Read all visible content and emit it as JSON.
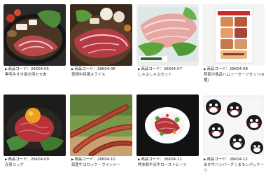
{
  "products": [
    {
      "code": "商品コード：26K04-05",
      "name": "黒毛牛すき焼き用モモ肉",
      "image_icon": "sukiyaki-pot-image"
    },
    {
      "code": "商品コード：26K04-06",
      "name": "宮崎牛特選スライス",
      "image_icon": "beef-slice-image"
    },
    {
      "code": "商品コード：26K04-07",
      "name": "しゃぶしゃぶセット",
      "image_icon": "pork-shabu-image"
    },
    {
      "code": "商品コード：26K04-08",
      "name": "阿部の逸品ハムソーセージセット(6種)",
      "image_icon": "ham-gift-box-image"
    },
    {
      "code": "商品コード：26K04-09",
      "name": "赤身ユッケ",
      "image_icon": "yukhoe-egg-image"
    },
    {
      "code": "商品コード：26K04-10",
      "name": "筑豊牛コロッケ・ウインナー",
      "image_icon": "sausage-image"
    },
    {
      "code": "商品コード：26K04-11",
      "name": "熊本和牛赤牛ローストビーフ",
      "image_icon": "roast-beef-salad-image"
    },
    {
      "code": "商品コード：26K04-12",
      "name": "あか牛ハンバーグくまモンパッケージ",
      "image_icon": "kumamon-package-image"
    }
  ]
}
